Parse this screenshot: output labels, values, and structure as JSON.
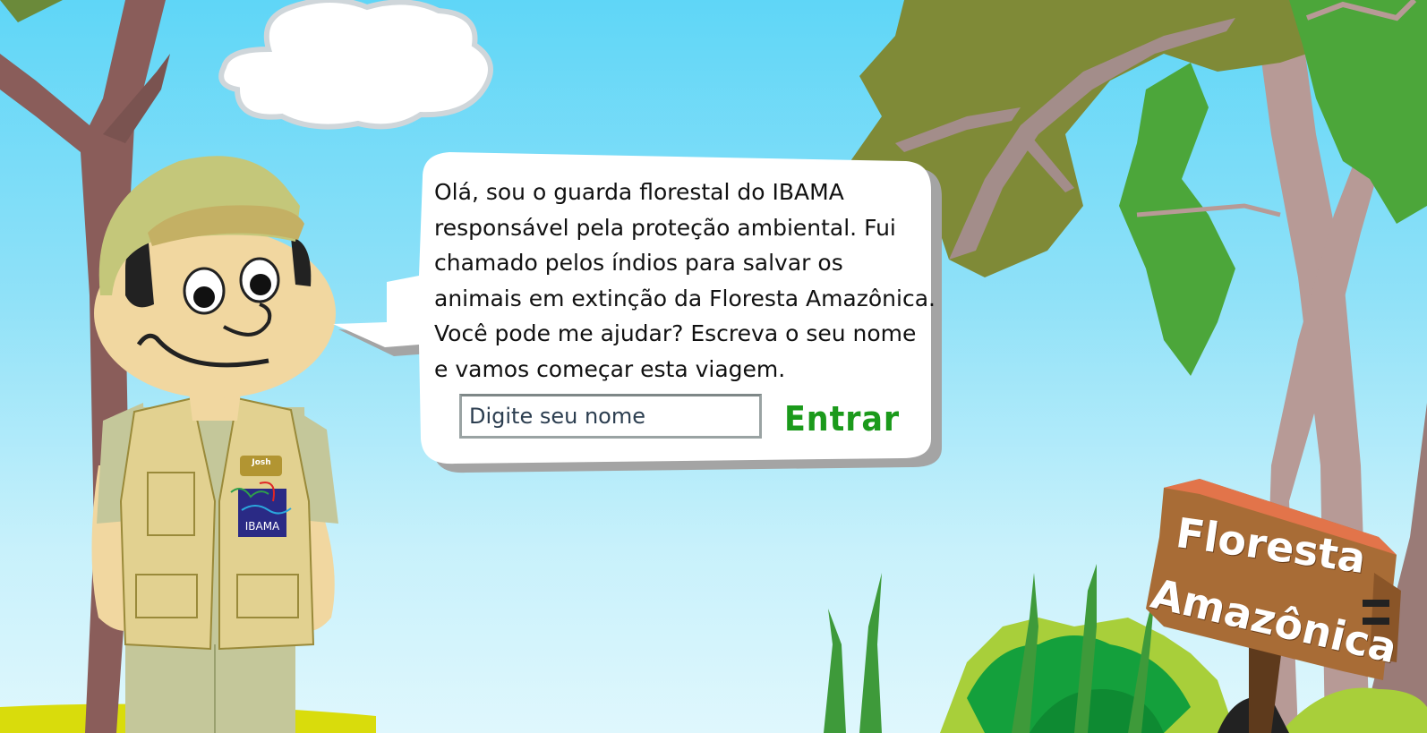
{
  "dialog": {
    "speech_text": "Olá, sou o guarda florestal do IBAMA responsável pela proteção ambiental. Fui chamado pelos índios para salvar os animais em extinção da Floresta Amazônica. Você pode me ajudar? Escreva o seu nome e vamos começar esta viagem.",
    "name_input": {
      "value": "",
      "placeholder": "Digite seu nome"
    },
    "enter_label": "Entrar"
  },
  "ranger": {
    "badge_name": "Josh",
    "patch_label": "IBAMA"
  },
  "sign": {
    "line1": "Floresta",
    "line2": "Amazônica"
  },
  "colors": {
    "sky_top": "#5fd6f7",
    "sky_bottom": "#dff7fd",
    "enter_button": "#1b9a1b",
    "sign_wood": "#a86c36"
  }
}
